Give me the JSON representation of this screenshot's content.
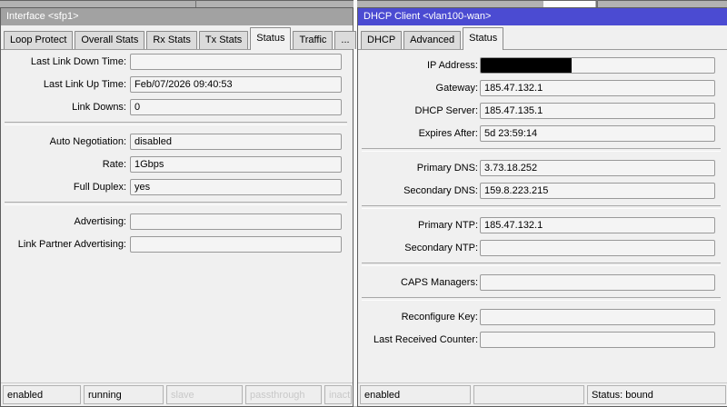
{
  "colors": {
    "active_titlebar": "#4b4bd2",
    "inactive_titlebar": "#a2a2a2",
    "panel_bg": "#f0f0f0",
    "disabled_status_text": "#c8c8c8",
    "redaction": "#000000"
  },
  "interface_window": {
    "title": "Interface <sfp1>",
    "tabs": [
      {
        "label": "Loop Protect"
      },
      {
        "label": "Overall Stats"
      },
      {
        "label": "Rx Stats"
      },
      {
        "label": "Tx Stats"
      },
      {
        "label": "Status",
        "active": true
      },
      {
        "label": "Traffic"
      },
      {
        "label": "...",
        "name": "overflow"
      }
    ],
    "fields": [
      {
        "type": "field",
        "label": "Last Link Down Time:",
        "value": ""
      },
      {
        "type": "field",
        "label": "Last Link Up Time:",
        "value": "Feb/07/2026 09:40:53"
      },
      {
        "type": "field",
        "label": "Link Downs:",
        "value": "0"
      },
      {
        "type": "separator"
      },
      {
        "type": "field",
        "label": "Auto Negotiation:",
        "value": "disabled"
      },
      {
        "type": "field",
        "label": "Rate:",
        "value": "1Gbps"
      },
      {
        "type": "field",
        "label": "Full Duplex:",
        "value": "yes"
      },
      {
        "type": "separator"
      },
      {
        "type": "field",
        "label": "Advertising:",
        "value": ""
      },
      {
        "type": "field",
        "label": "Link Partner Advertising:",
        "value": ""
      }
    ],
    "status_cells": [
      {
        "label": "enabled"
      },
      {
        "label": "running"
      },
      {
        "label": "slave",
        "disabled": true
      },
      {
        "label": "passthrough",
        "disabled": true
      },
      {
        "label": "inact",
        "disabled": true
      }
    ]
  },
  "dhcp_client_window": {
    "title": "DHCP Client <vlan100-wan>",
    "tabs": [
      {
        "label": "DHCP"
      },
      {
        "label": "Advanced"
      },
      {
        "label": "Status",
        "active": true
      }
    ],
    "fields": [
      {
        "type": "field",
        "label": "IP Address:",
        "value": "",
        "redacted": true
      },
      {
        "type": "field",
        "label": "Gateway:",
        "value": "185.47.132.1"
      },
      {
        "type": "field",
        "label": "DHCP Server:",
        "value": "185.47.135.1"
      },
      {
        "type": "field",
        "label": "Expires After:",
        "value": "5d 23:59:14"
      },
      {
        "type": "separator"
      },
      {
        "type": "field",
        "label": "Primary DNS:",
        "value": "3.73.18.252"
      },
      {
        "type": "field",
        "label": "Secondary DNS:",
        "value": "159.8.223.215"
      },
      {
        "type": "separator"
      },
      {
        "type": "field",
        "label": "Primary NTP:",
        "value": "185.47.132.1"
      },
      {
        "type": "field",
        "label": "Secondary NTP:",
        "value": ""
      },
      {
        "type": "separator"
      },
      {
        "type": "field",
        "label": "CAPS Managers:",
        "value": ""
      },
      {
        "type": "separator"
      },
      {
        "type": "field",
        "label": "Reconfigure Key:",
        "value": ""
      },
      {
        "type": "field",
        "label": "Last Received Counter:",
        "value": ""
      }
    ],
    "status_cells": [
      {
        "label": "enabled"
      },
      {
        "label": ""
      },
      {
        "label": "Status: bound"
      }
    ]
  }
}
